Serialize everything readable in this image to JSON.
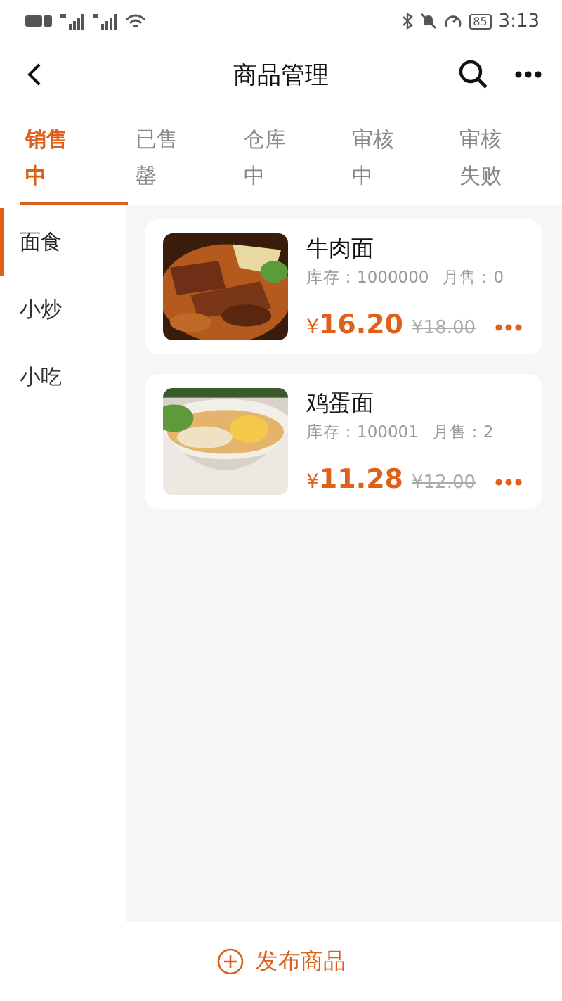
{
  "status_bar": {
    "battery": "85",
    "time": "3:13"
  },
  "header": {
    "title": "商品管理"
  },
  "tabs": [
    {
      "label": "销售中",
      "selected": true
    },
    {
      "label": "已售罄",
      "selected": false
    },
    {
      "label": "仓库中",
      "selected": false
    },
    {
      "label": "审核中",
      "selected": false
    },
    {
      "label": "审核失败",
      "selected": false
    }
  ],
  "categories": [
    {
      "label": "面食",
      "selected": true
    },
    {
      "label": "小炒",
      "selected": false
    },
    {
      "label": "小吃",
      "selected": false
    }
  ],
  "products": [
    {
      "name": "牛肉面",
      "stock": "库存：1000000",
      "sales": "月售：0",
      "currency": "¥",
      "price": "16.20",
      "original_price": "¥18.00",
      "kind": "picture"
    },
    {
      "name": "鸡蛋面",
      "stock": "库存：100001",
      "sales": "月售：2",
      "currency": "¥",
      "price": "11.28",
      "original_price": "¥12.00",
      "kind": "picture"
    }
  ],
  "add_button": {
    "label": "发布商品"
  }
}
